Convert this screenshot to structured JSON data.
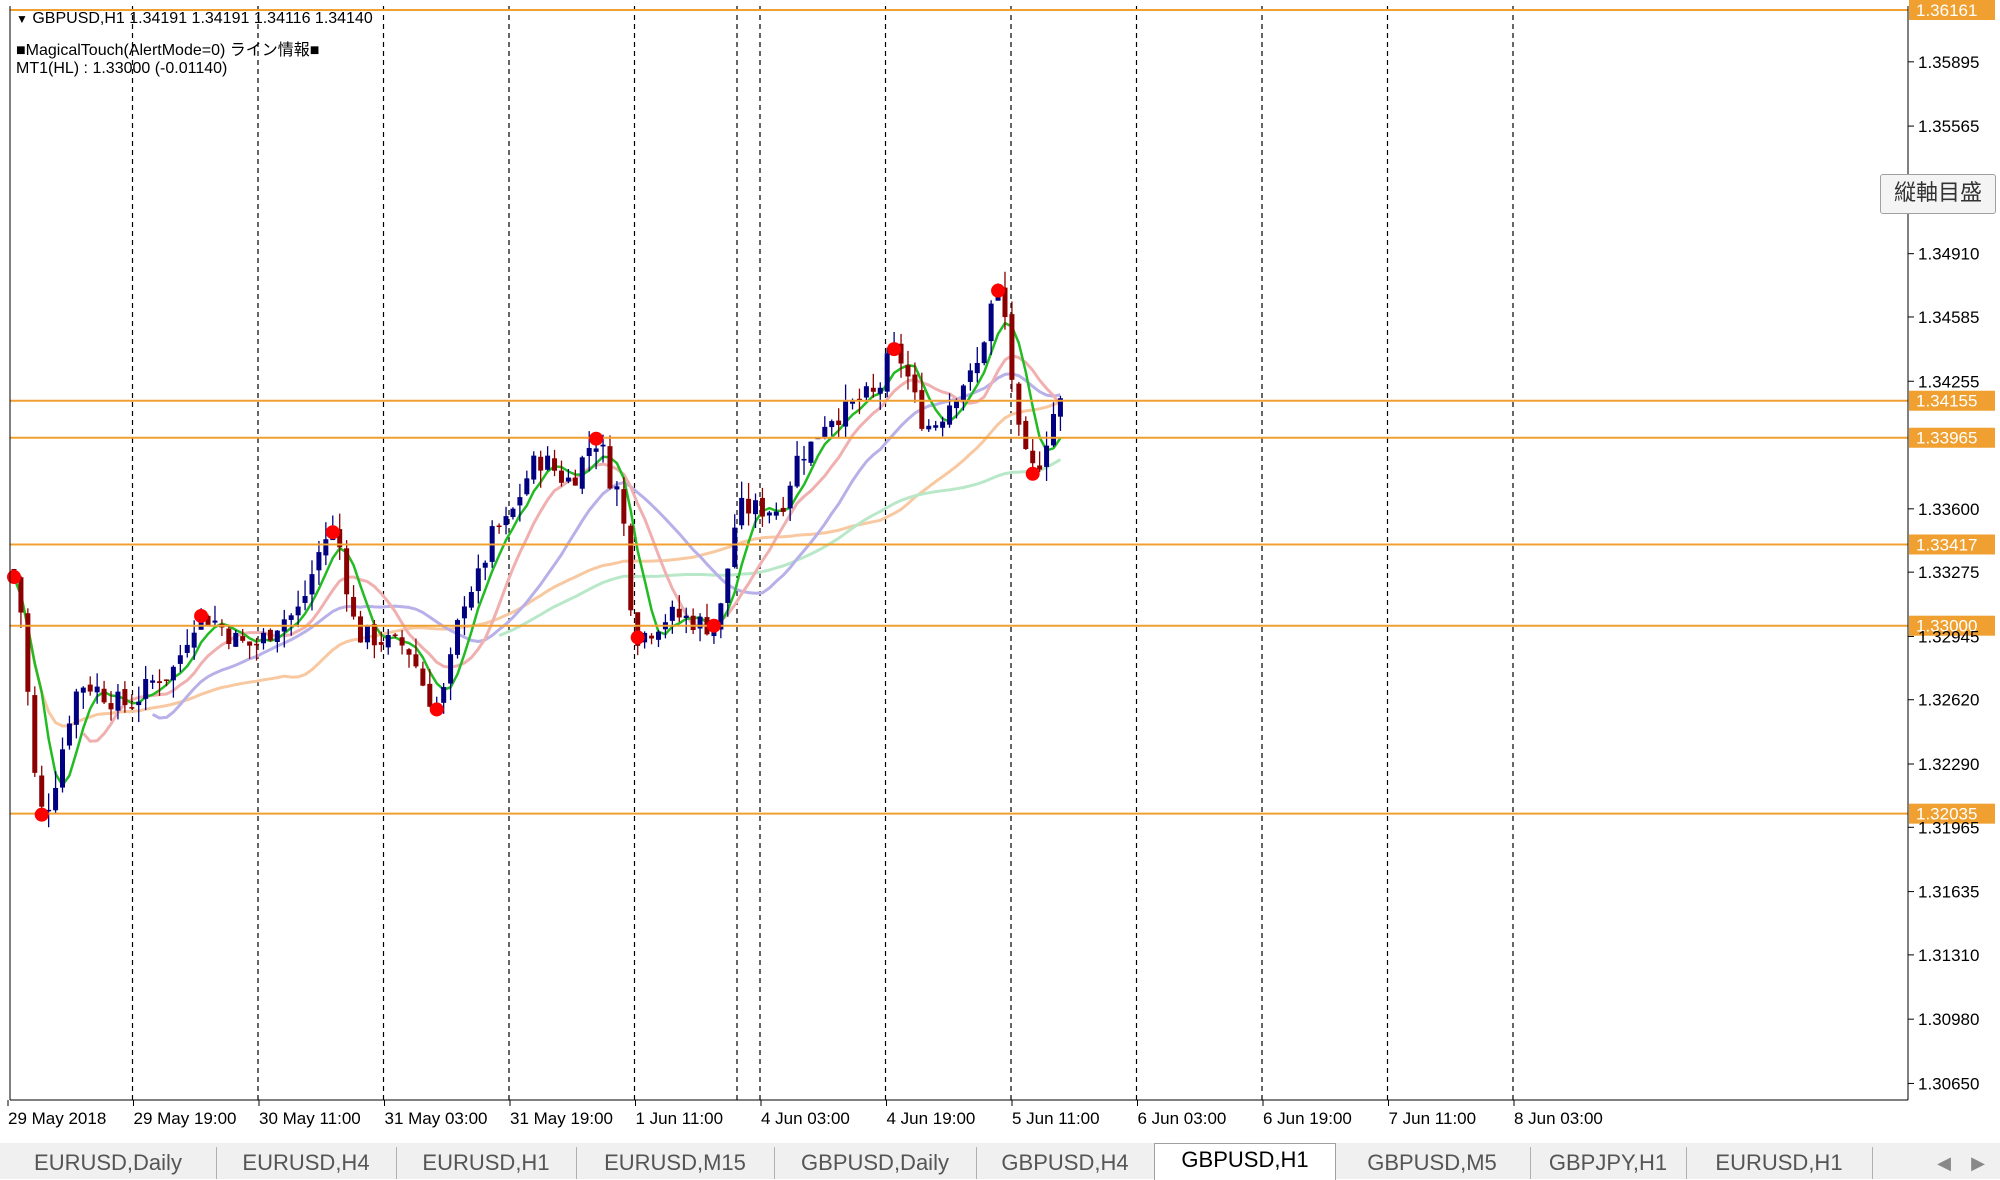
{
  "chart": {
    "symbol_line": "GBPUSD,H1  1.34191 1.34191 1.34116 1.34140",
    "indicator_line": "■MagicalTouch(AlertMode=0) ライン情報■",
    "mt1_line": "MT1(HL) : 1.33000 (-0.01140)",
    "vaxis_button": "縦軸目盛",
    "colors": {
      "candle_up": "#000080",
      "candle_down": "#8b0000",
      "level_line": "#f0a030",
      "level_label_bg": "#f0a030",
      "swing_dot": "#ff0000",
      "ma_fast": "#22bb22",
      "ma_lavender": "#b8b0e8",
      "ma_pink": "#f0b0b0",
      "ma_peach": "#f8c8a0",
      "ma_mint": "#b8e8c8"
    }
  },
  "chart_data": {
    "type": "candlestick",
    "title": "GBPUSD,H1",
    "ylim": [
      1.30565,
      1.36161
    ],
    "price_ticks": [
      "1.35895",
      "1.35565",
      "1.34910",
      "1.34585",
      "1.34255",
      "1.33600",
      "1.33275",
      "1.32945",
      "1.32620",
      "1.32290",
      "1.31965",
      "1.31635",
      "1.31310",
      "1.30980",
      "1.30650"
    ],
    "time_labels": [
      "29 May 2018",
      "29 May 19:00",
      "30 May 11:00",
      "31 May 03:00",
      "31 May 19:00",
      "1 Jun 11:00",
      "4 Jun 03:00",
      "4 Jun 19:00",
      "5 Jun 11:00",
      "6 Jun 03:00",
      "6 Jun 19:00",
      "7 Jun 11:00",
      "8 Jun 03:00"
    ],
    "levels": [
      {
        "price": 1.36161,
        "label": "1.36161"
      },
      {
        "price": 1.34155,
        "label": "1.34155"
      },
      {
        "price": 1.33965,
        "label": "1.33965"
      },
      {
        "price": 1.33417,
        "label": "1.33417"
      },
      {
        "price": 1.33,
        "label": "1.33000"
      },
      {
        "price": 1.32035,
        "label": "1.32035"
      }
    ],
    "swing_points": [
      {
        "bar": 0,
        "price": 1.3325
      },
      {
        "bar": 4,
        "price": 1.3203
      },
      {
        "bar": 27,
        "price": 1.3305
      },
      {
        "bar": 46,
        "price": 1.3348
      },
      {
        "bar": 61,
        "price": 1.3257
      },
      {
        "bar": 84,
        "price": 1.3396
      },
      {
        "bar": 90,
        "price": 1.3294
      },
      {
        "bar": 101,
        "price": 1.33
      },
      {
        "bar": 127,
        "price": 1.3442
      },
      {
        "bar": 142,
        "price": 1.3472
      },
      {
        "bar": 147,
        "price": 1.3378
      }
    ]
  },
  "tabs": [
    {
      "label": "EURUSD,Daily"
    },
    {
      "label": "EURUSD,H4"
    },
    {
      "label": "EURUSD,H1"
    },
    {
      "label": "EURUSD,M15"
    },
    {
      "label": "GBPUSD,Daily"
    },
    {
      "label": "GBPUSD,H4"
    },
    {
      "label": "GBPUSD,H1"
    },
    {
      "label": "GBPUSD,M5"
    },
    {
      "label": "GBPJPY,H1"
    },
    {
      "label": "EURUSD,H1"
    }
  ],
  "active_tab": "GBPUSD,H1",
  "tab_nav": {
    "left": "◀",
    "right": "▶"
  }
}
